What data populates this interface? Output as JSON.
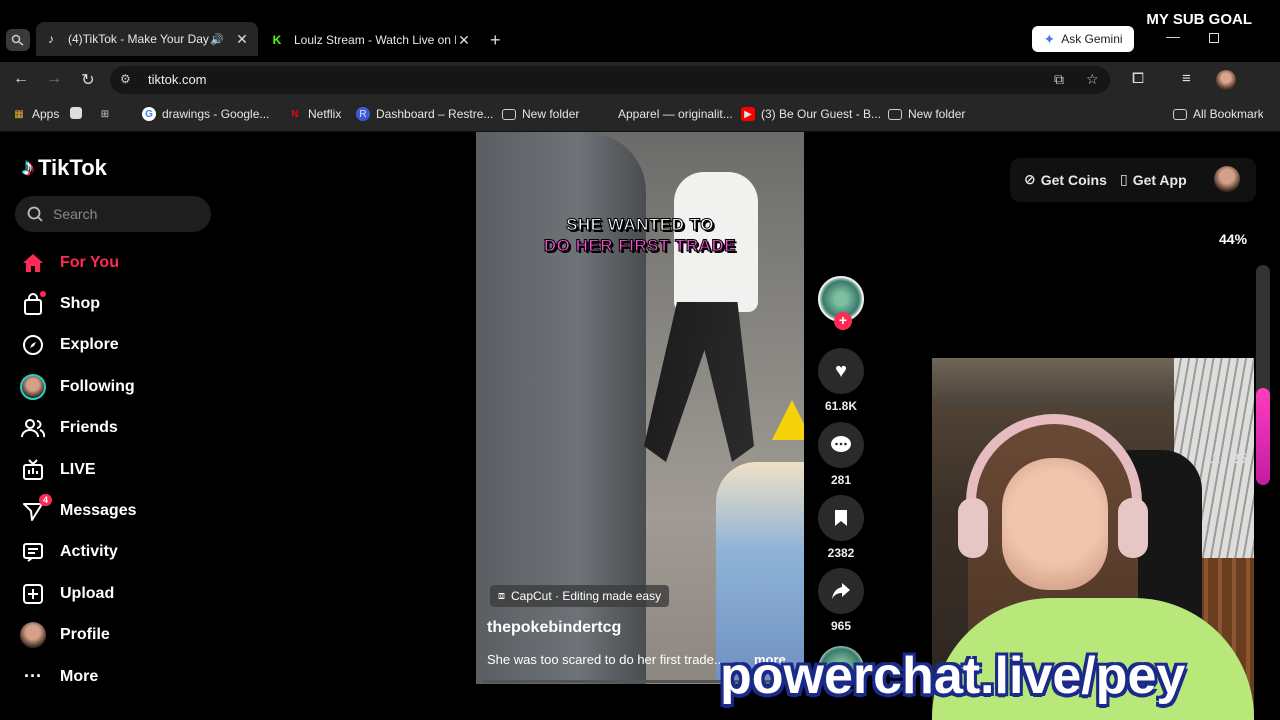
{
  "browser": {
    "tabs": [
      {
        "title": "(4)TikTok - Make Your Day",
        "icon": "tiktok-icon",
        "active": true,
        "audio": true
      },
      {
        "title": "Loulz Stream - Watch Live on K",
        "icon": "kick-icon",
        "active": false
      }
    ],
    "gemini_label": "Ask Gemini",
    "url": "tiktok.com",
    "bookmarks": [
      "Apps",
      "drawings - Google...",
      "Netflix",
      "Dashboard – Restre...",
      "New folder",
      "Apparel — originalit...",
      "(3) Be Our Guest - B...",
      "New folder",
      "All Bookmarks"
    ]
  },
  "overlay": {
    "sub_goal_title": "MY SUB GOAL",
    "sub_goal_percent": "44%",
    "sub_goal_value": 0.44,
    "slide_counter": "11 / 25",
    "link_text": "powerchat.live/pey"
  },
  "tiktok": {
    "logo": "TikTok",
    "search_placeholder": "Search",
    "nav": [
      "For You",
      "Shop",
      "Explore",
      "Following",
      "Friends",
      "LIVE",
      "Messages",
      "Activity",
      "Upload",
      "Profile",
      "More"
    ],
    "messages_badge": "4",
    "top_right": {
      "coins": "Get Coins",
      "app": "Get App"
    },
    "video": {
      "caption_line1": "SHE WANTED TO",
      "caption_line2": "DO HER FIRST TRADE",
      "capcut": "CapCut · Editing made easy",
      "username": "thepokebindertcg",
      "description": "She was too scared to do her first trade...",
      "more": "more"
    },
    "actions": {
      "likes": "61.8K",
      "comments": "281",
      "saves": "2382",
      "shares": "965"
    }
  },
  "colors": {
    "accent": "#fe2c55",
    "goal_fill": "#e030b8"
  }
}
